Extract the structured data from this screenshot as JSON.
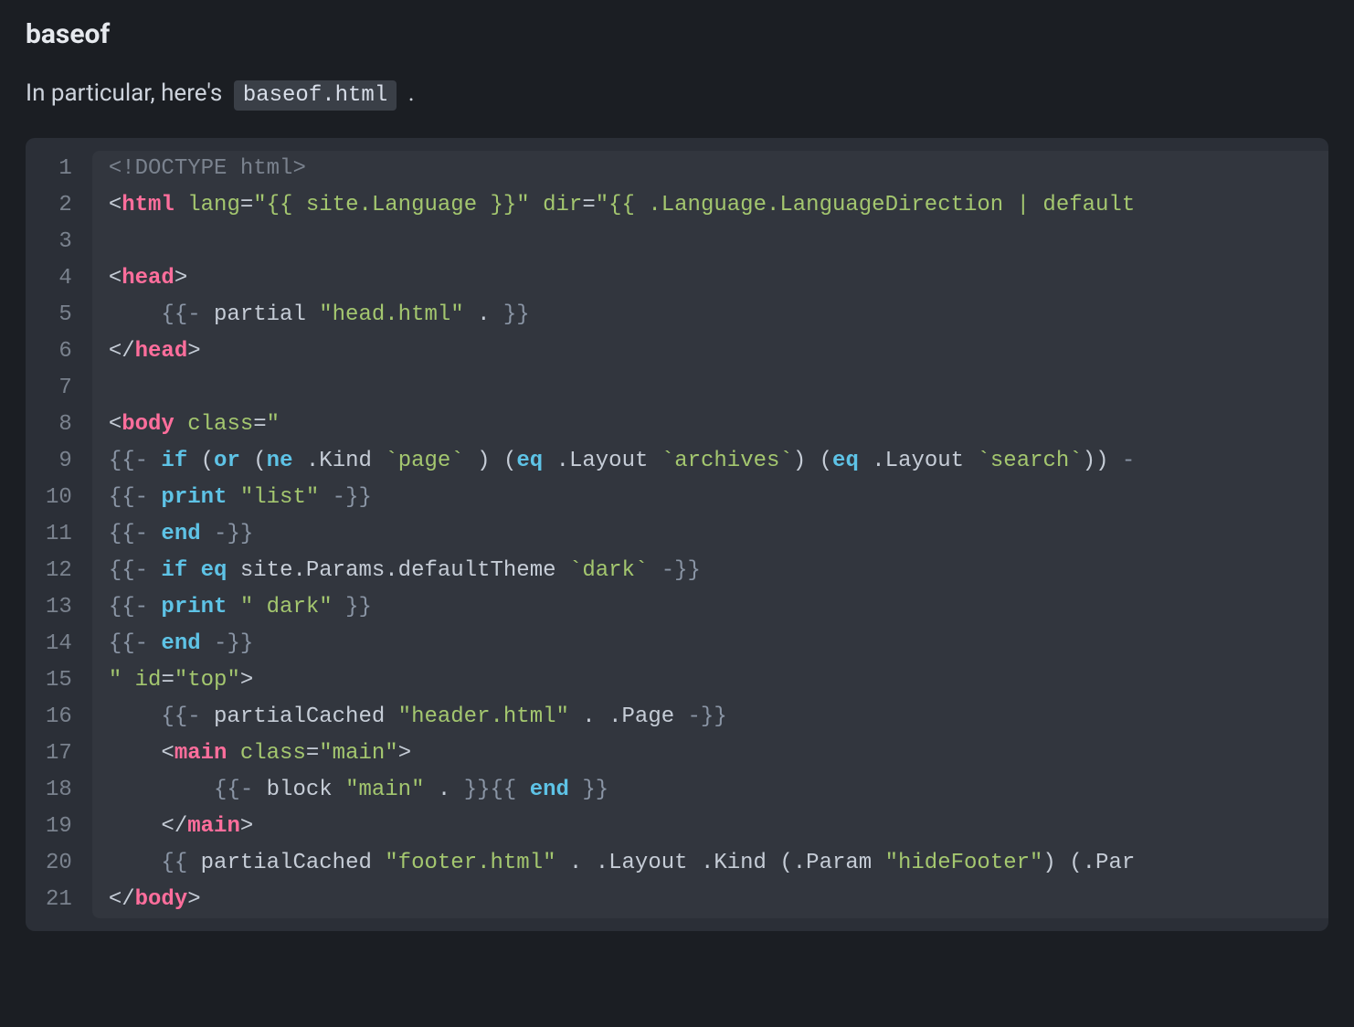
{
  "heading": "baseof",
  "intro_prefix": "In particular, here's ",
  "intro_code": "baseof.html",
  "intro_suffix": " .",
  "line_numbers": [
    "1",
    "2",
    "3",
    "4",
    "5",
    "6",
    "7",
    "8",
    "9",
    "10",
    "11",
    "12",
    "13",
    "14",
    "15",
    "16",
    "17",
    "18",
    "19",
    "20",
    "21"
  ],
  "code": {
    "l1": {
      "a": "<!DOCTYPE html>"
    },
    "l2": {
      "a": "<",
      "b": "html",
      "c": " ",
      "d": "lang",
      "e": "=",
      "f": "\"{{ site.Language }}\"",
      "g": " ",
      "h": "dir",
      "i": "=",
      "j": "\"{{ .Language.LanguageDirection | default",
      "k": " "
    },
    "l3": {
      "a": ""
    },
    "l4": {
      "a": "<",
      "b": "head",
      "c": ">"
    },
    "l5": {
      "a": "    ",
      "b": "{{- ",
      "c": "partial ",
      "d": "\"head.html\"",
      "e": " . ",
      "f": "}}"
    },
    "l6": {
      "a": "</",
      "b": "head",
      "c": ">"
    },
    "l7": {
      "a": ""
    },
    "l8": {
      "a": "<",
      "b": "body",
      "c": " ",
      "d": "class",
      "e": "=",
      "f": "\""
    },
    "l9": {
      "a": "{{- ",
      "b": "if",
      "c": " ",
      "d": "(",
      "e": "or",
      "f": " ",
      "g": "(",
      "h": "ne",
      "i": " .Kind ",
      "j": "`page`",
      "k": " ",
      "l": ")",
      "m": " ",
      "n": "(",
      "o": "eq",
      "p": " .Layout ",
      "q": "`archives`",
      "r": ")",
      "s": " ",
      "t": "(",
      "u": "eq",
      "v": " .Layout ",
      "w": "`search`",
      "x": ")",
      "y": ")",
      "z": " -"
    },
    "l10": {
      "a": "{{- ",
      "b": "print",
      "c": " ",
      "d": "\"list\"",
      "e": " ",
      "f": "-}}"
    },
    "l11": {
      "a": "{{- ",
      "b": "end",
      "c": " ",
      "d": "-}}"
    },
    "l12": {
      "a": "{{- ",
      "b": "if",
      "c": " ",
      "d": "eq",
      "e": " site.Params.defaultTheme ",
      "f": "`dark`",
      "g": " ",
      "h": "-}}"
    },
    "l13": {
      "a": "{{- ",
      "b": "print",
      "c": " ",
      "d": "\" dark\"",
      "e": " ",
      "f": "}}"
    },
    "l14": {
      "a": "{{- ",
      "b": "end",
      "c": " ",
      "d": "-}}"
    },
    "l15": {
      "a": "\"",
      "b": " ",
      "c": "id",
      "d": "=",
      "e": "\"top\"",
      "f": ">"
    },
    "l16": {
      "a": "    ",
      "b": "{{- ",
      "c": "partialCached ",
      "d": "\"header.html\"",
      "e": " . .Page ",
      "f": "-}}"
    },
    "l17": {
      "a": "    <",
      "b": "main",
      "c": " ",
      "d": "class",
      "e": "=",
      "f": "\"main\"",
      "g": ">"
    },
    "l18": {
      "a": "        ",
      "b": "{{- ",
      "c": "block ",
      "d": "\"main\"",
      "e": " . ",
      "f": "}}",
      "g": "{{ ",
      "h": "end",
      "i": " ",
      "j": "}}"
    },
    "l19": {
      "a": "    </",
      "b": "main",
      "c": ">"
    },
    "l20": {
      "a": "    ",
      "b": "{{ ",
      "c": "partialCached ",
      "d": "\"footer.html\"",
      "e": " . .Layout .Kind ",
      "f": "(",
      "g": ".Param ",
      "h": "\"hideFooter\"",
      "i": ")",
      "j": " ",
      "k": "(",
      "l": ".Par"
    },
    "l21": {
      "a": "</",
      "b": "body",
      "c": ">"
    }
  }
}
